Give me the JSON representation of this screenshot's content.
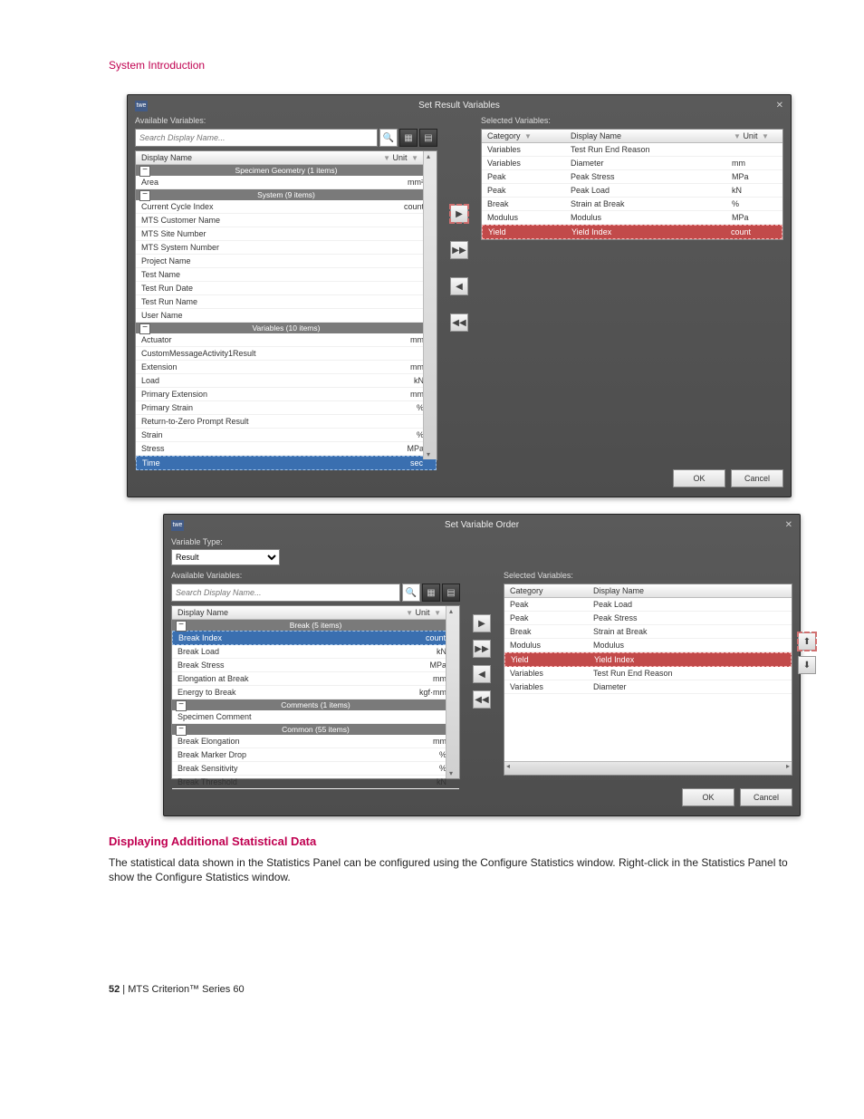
{
  "page": {
    "section_header": "System Introduction",
    "sub_heading": "Displaying Additional Statistical Data",
    "body_text": "The statistical data shown in the Statistics Panel can be configured using the Configure Statistics window. Right-click in the Statistics Panel to show the Configure Statistics window.",
    "footer_page": "52",
    "footer_text": " | MTS Criterion™ Series 60"
  },
  "dialog1": {
    "app_icon": "twe",
    "title": "Set Result Variables",
    "close": "✕",
    "available_label": "Available Variables:",
    "selected_label": "Selected Variables:",
    "search_placeholder": "Search Display Name...",
    "col_display": "Display Name",
    "col_unit": "Unit",
    "col_category": "Category",
    "groups": [
      {
        "name": "Specimen Geometry (1 items)",
        "rows": [
          {
            "disp": "Area",
            "unit": "mm²"
          }
        ]
      },
      {
        "name": "System (9 items)",
        "rows": [
          {
            "disp": "Current Cycle Index",
            "unit": "count"
          },
          {
            "disp": "MTS Customer Name",
            "unit": ""
          },
          {
            "disp": "MTS Site Number",
            "unit": ""
          },
          {
            "disp": "MTS System Number",
            "unit": ""
          },
          {
            "disp": "Project Name",
            "unit": ""
          },
          {
            "disp": "Test Name",
            "unit": ""
          },
          {
            "disp": "Test Run Date",
            "unit": ""
          },
          {
            "disp": "Test Run Name",
            "unit": ""
          },
          {
            "disp": "User Name",
            "unit": ""
          }
        ]
      },
      {
        "name": "Variables (10 items)",
        "rows": [
          {
            "disp": "Actuator",
            "unit": "mm"
          },
          {
            "disp": "CustomMessageActivity1Result",
            "unit": ""
          },
          {
            "disp": "Extension",
            "unit": "mm"
          },
          {
            "disp": "Load",
            "unit": "kN"
          },
          {
            "disp": "Primary Extension",
            "unit": "mm"
          },
          {
            "disp": "Primary Strain",
            "unit": "%"
          },
          {
            "disp": "Return-to-Zero Prompt Result",
            "unit": ""
          },
          {
            "disp": "Strain",
            "unit": "%"
          },
          {
            "disp": "Stress",
            "unit": "MPa"
          },
          {
            "disp": "Time",
            "unit": "sec",
            "hl": "blue"
          }
        ]
      }
    ],
    "selected_rows": [
      {
        "cat": "Variables",
        "disp": "Test Run End Reason",
        "unit": ""
      },
      {
        "cat": "Variables",
        "disp": "Diameter",
        "unit": "mm"
      },
      {
        "cat": "Peak",
        "disp": "Peak Stress",
        "unit": "MPa"
      },
      {
        "cat": "Peak",
        "disp": "Peak Load",
        "unit": "kN"
      },
      {
        "cat": "Break",
        "disp": "Strain at Break",
        "unit": "%"
      },
      {
        "cat": "Modulus",
        "disp": "Modulus",
        "unit": "MPa"
      },
      {
        "cat": "Yield",
        "disp": "Yield Index",
        "unit": "count",
        "hl": "red"
      }
    ],
    "ok": "OK",
    "cancel": "Cancel"
  },
  "dialog2": {
    "app_icon": "twe",
    "title": "Set Variable Order",
    "close": "✕",
    "var_type_label": "Variable Type:",
    "var_type_value": "Result",
    "available_label": "Available Variables:",
    "selected_label": "Selected Variables:",
    "search_placeholder": "Search Display Name...",
    "col_display": "Display Name",
    "col_unit": "Unit",
    "col_category": "Category",
    "groups": [
      {
        "name": "Break (5 items)",
        "rows": [
          {
            "disp": "Break Index",
            "unit": "count",
            "hl": "blue"
          },
          {
            "disp": "Break Load",
            "unit": "kN"
          },
          {
            "disp": "Break Stress",
            "unit": "MPa"
          },
          {
            "disp": "Elongation at Break",
            "unit": "mm"
          },
          {
            "disp": "Energy to Break",
            "unit": "kgf·mm"
          }
        ]
      },
      {
        "name": "Comments (1 items)",
        "rows": [
          {
            "disp": "Specimen Comment",
            "unit": ""
          }
        ]
      },
      {
        "name": "Common (55 items)",
        "rows": [
          {
            "disp": "Break Elongation",
            "unit": "mm"
          },
          {
            "disp": "Break Marker Drop",
            "unit": "%"
          },
          {
            "disp": "Break Sensitivity",
            "unit": "%"
          },
          {
            "disp": "Break Threshold",
            "unit": "kN"
          }
        ]
      }
    ],
    "selected_rows": [
      {
        "cat": "Peak",
        "disp": "Peak Load"
      },
      {
        "cat": "Peak",
        "disp": "Peak Stress"
      },
      {
        "cat": "Break",
        "disp": "Strain at Break"
      },
      {
        "cat": "Modulus",
        "disp": "Modulus"
      },
      {
        "cat": "Yield",
        "disp": "Yield Index",
        "hl": "red"
      },
      {
        "cat": "Variables",
        "disp": "Test Run End Reason"
      },
      {
        "cat": "Variables",
        "disp": "Diameter"
      }
    ],
    "ok": "OK",
    "cancel": "Cancel"
  },
  "glyphs": {
    "filter": "▼",
    "search": "🔍",
    "grid": "▦",
    "list": "▤",
    "right": "▶",
    "right2": "▶▶",
    "left": "◀",
    "left2": "◀◀",
    "up": "⬆",
    "down": "⬇"
  }
}
